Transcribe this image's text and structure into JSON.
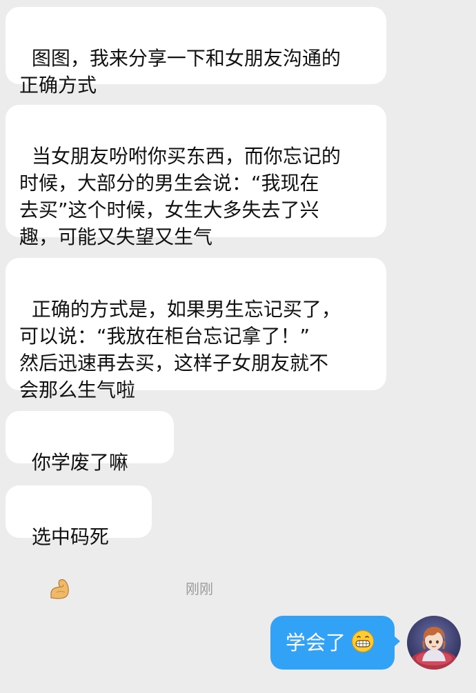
{
  "conversation": {
    "messages": [
      {
        "sender": "them",
        "text": "图图，我来分享一下和女朋友沟通的\n正确方式"
      },
      {
        "sender": "them",
        "text": "当女朋友吩咐你买东西，而你忘记的\n时候，大部分的男生会说：“我现在\n去买”这个时候，女生大多失去了兴\n趣，可能又失望又生气"
      },
      {
        "sender": "them",
        "text": "正确的方式是，如果男生忘记买了，\n可以说：“我放在柜台忘记拿了！”\n然后迅速再去买，这样子女朋友就不\n会那么生气啦"
      },
      {
        "sender": "them",
        "text": "你学废了嘛",
        "emoji": "grinning-face-emoji"
      },
      {
        "sender": "them",
        "text": "选中码死",
        "emoji": "flexed-biceps-emoji"
      }
    ],
    "timestamp": "刚刚",
    "reply": {
      "sender": "me",
      "text": "学会了",
      "emoji": "grinning-face-emoji"
    }
  },
  "colors": {
    "background": "#ececec",
    "incoming_bubble": "#ffffff",
    "outgoing_bubble": "#31a2f6",
    "timestamp_text": "#9a9a9a"
  }
}
